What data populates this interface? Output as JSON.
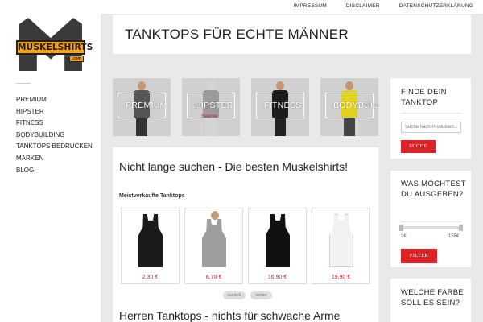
{
  "logo": {
    "text": "MUSKELSHIRTS",
    "suffix": ".com"
  },
  "sidebar": {
    "items": [
      {
        "label": "PREMIUM"
      },
      {
        "label": "HIPSTER"
      },
      {
        "label": "FITNESS"
      },
      {
        "label": "BODYBUILDING"
      },
      {
        "label": "TANKTOPS BEDRUCKEN"
      },
      {
        "label": "MARKEN"
      },
      {
        "label": "BLOG"
      }
    ]
  },
  "topbar": {
    "links": [
      "IMPRESSUM",
      "DISCLAIMER",
      "DATENSCHUTZERKLÄRUNG"
    ]
  },
  "header": {
    "title": "TANKTOPS FÜR ECHTE MÄNNER"
  },
  "tiles": [
    {
      "label": "PREMIUM",
      "color": "#555555",
      "bg": "#cfcfcf"
    },
    {
      "label": "HIPSTER",
      "color": "#9a9a9a",
      "bg": "#d4d4d4",
      "print": "Swerve"
    },
    {
      "label": "FITNESS",
      "color": "#1c1c1c",
      "bg": "#cdcdcd"
    },
    {
      "label": "BODYBUILDING",
      "color": "#e2d21e",
      "bg": "#d1d1d1"
    }
  ],
  "main": {
    "heading": "Nicht lange suchen - Die besten Muskelshirts!",
    "subheading": "Meistverkaufte Tanktops",
    "products": [
      {
        "price": "2,30 €",
        "color": "#1a1a1a"
      },
      {
        "price": "6,70 €",
        "color": "#9d9d9d"
      },
      {
        "price": "16,90 €",
        "color": "#111111"
      },
      {
        "price": "19,90 €",
        "color": "#f2f2f2"
      }
    ],
    "pager": {
      "prev": "zurück",
      "next": "weiter"
    },
    "heading2": "Herren Tanktops - nichts für schwache Arme"
  },
  "widgets": {
    "search": {
      "title": "FINDE DEIN TANKTOP",
      "placeholder": "Suche nach Produkten...",
      "button": "SUCHE"
    },
    "price": {
      "title": "WAS MÖCHTEST DU AUSGEBEN?",
      "min": "2€",
      "max": "155€",
      "button": "FILTER"
    },
    "color": {
      "title": "WELCHE FARBE SOLL ES SEIN?"
    }
  },
  "colors": {
    "accent": "#dd2328",
    "price": "#d8232a",
    "logo": "#f2a11f"
  }
}
